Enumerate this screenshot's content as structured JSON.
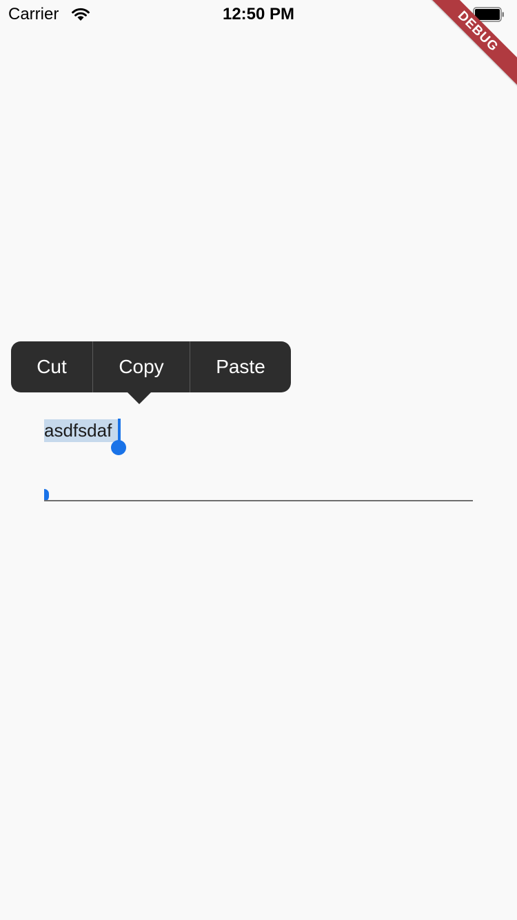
{
  "status_bar": {
    "carrier": "Carrier",
    "time": "12:50 PM",
    "wifi_icon": "wifi-icon",
    "battery_icon": "battery-icon"
  },
  "debug_banner": {
    "label": "DEBUG",
    "color": "#b03a40"
  },
  "toolbar": {
    "cut_label": "Cut",
    "copy_label": "Copy",
    "paste_label": "Paste",
    "background": "#2d2d2d"
  },
  "text_field": {
    "value": "asdfsdaf",
    "accent_color": "#1a73e8",
    "selection_color": "#c6d9ec"
  }
}
